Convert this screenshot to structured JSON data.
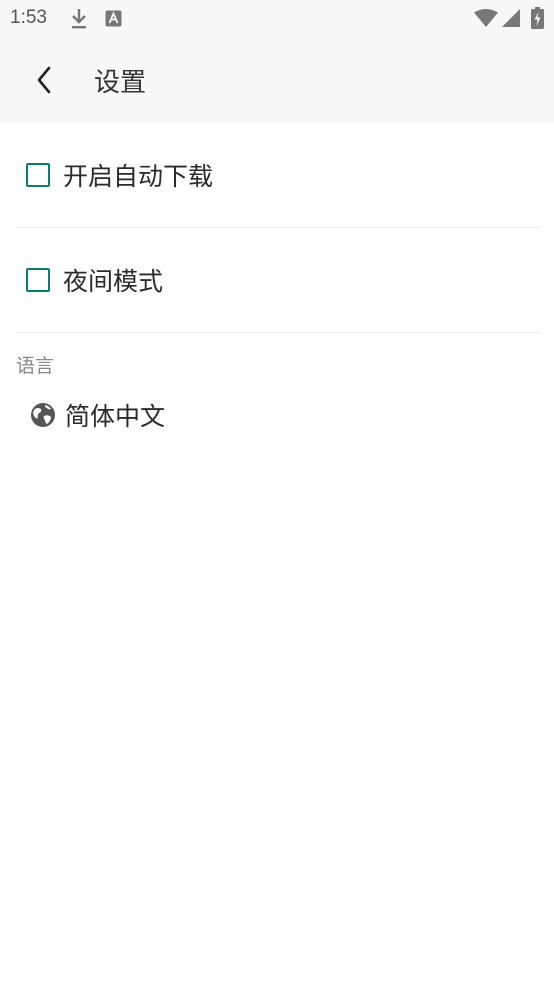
{
  "status_bar": {
    "time": "1:53"
  },
  "app_bar": {
    "title": "设置"
  },
  "settings": {
    "auto_download": {
      "label": "开启自动下载",
      "checked": false
    },
    "night_mode": {
      "label": "夜间模式",
      "checked": false
    }
  },
  "language": {
    "section_title": "语言",
    "current": "简体中文"
  },
  "colors": {
    "accent": "#0a7d71",
    "appbar_bg": "#f7f7f7"
  }
}
